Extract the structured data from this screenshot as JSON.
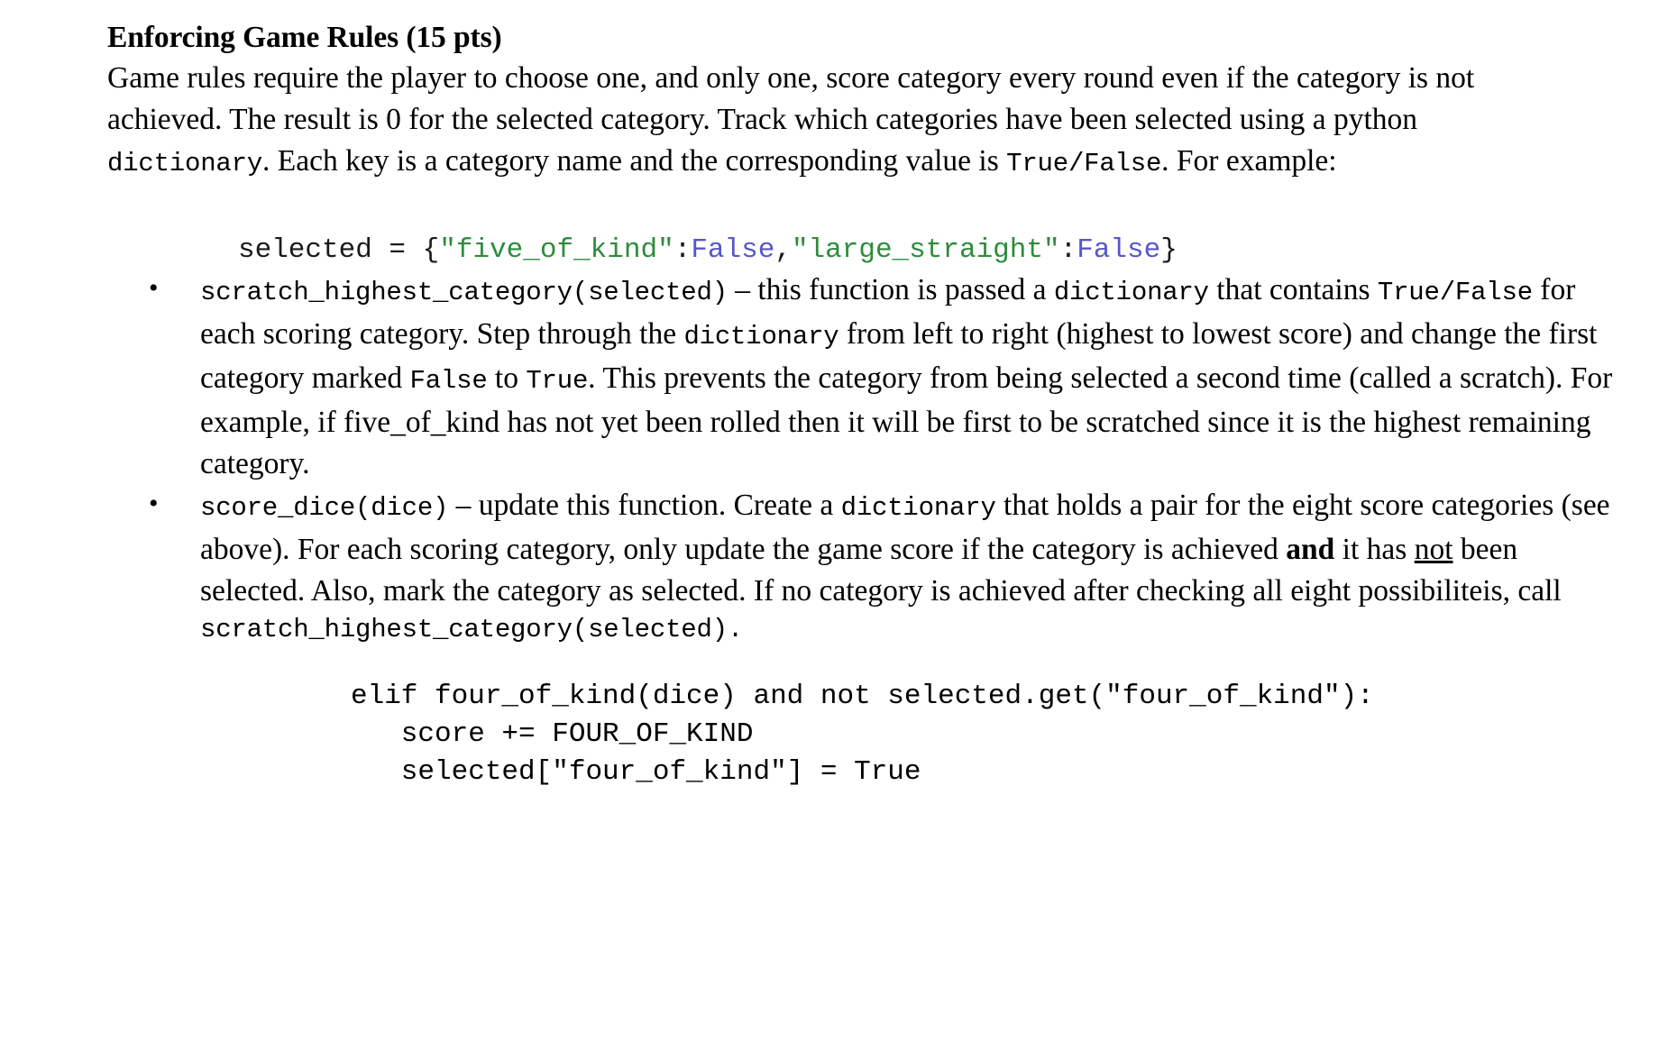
{
  "document": {
    "title": "Enforcing Game Rules (15 pts)",
    "intro": {
      "part1": "Game rules require the player to choose one, and only one, score category every round even if the category is not achieved. The result is 0 for the selected category. Track which categories have been selected using a python ",
      "code1": "dictionary",
      "part2": ". Each key is a category name and the corresponding value is ",
      "code2": "True/False",
      "part3": ". For example:"
    },
    "code_example_1": {
      "prefix": "selected = {",
      "key1": "\"five_of_kind\"",
      "colon1": ":",
      "bool1": "False",
      "comma": ",",
      "key2": "\"large_straight\"",
      "colon2": ":",
      "bool2": "False",
      "suffix": "}"
    },
    "bullets": [
      {
        "name": "scratch-highest-category",
        "signature": "scratch_highest_category(selected)",
        "seg1": " – this function is passed a ",
        "code1": "dictionary",
        "seg2": " that contains ",
        "code2": "True/False",
        "seg3": " for each scoring category. Step through the ",
        "code3": "dictionary",
        "seg4": " from left to right (highest to lowest score) and change the first category marked ",
        "code4": "False",
        "seg5": " to ",
        "code5": "True",
        "seg6": ". This prevents the category from being selected a second time (called a scratch). For example, if five_of_kind has not yet been rolled then it will be first to be scratched since it is the highest remaining category."
      },
      {
        "name": "score-dice",
        "signature": "score_dice(dice)",
        "seg1": " – update this function. Create a ",
        "code1": "dictionary",
        "seg2": " that holds a pair for the eight score categories (see above). For each scoring category, only update the game score if the category is achieved ",
        "bold1": "and",
        "seg3": " it has ",
        "underline1": "not",
        "seg4": " been selected. Also, mark the category as selected. If no category is achieved after checking all eight possibiliteis, call",
        "code_tail": "scratch_highest_category(selected)."
      }
    ],
    "code_example_2": {
      "line1": "elif four_of_kind(dice) and not selected.get(\"four_of_kind\"):",
      "line2": "   score += FOUR_OF_KIND",
      "line3": "   selected[\"four_of_kind\"] = True"
    },
    "colors": {
      "text": "#000000",
      "string": "#2e8b3d",
      "boolean": "#5757c7",
      "background": "#ffffff"
    }
  }
}
